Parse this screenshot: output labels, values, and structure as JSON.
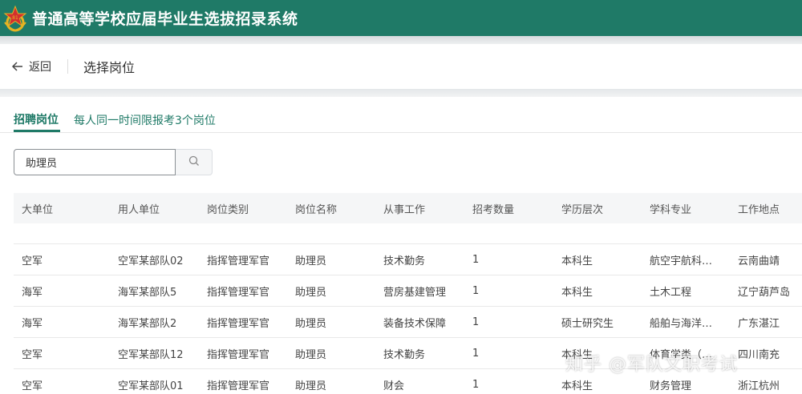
{
  "app": {
    "title": "普通高等学校应届毕业生选拔招录系统",
    "brand_color": "#1f7a67"
  },
  "subheader": {
    "back_label": "返回",
    "page_title": "选择岗位"
  },
  "tabs": {
    "active_label": "招聘岗位",
    "note": "每人同一时间限报考3个岗位"
  },
  "search": {
    "value": "助理员"
  },
  "table": {
    "headers": [
      "大单位",
      "用人单位",
      "岗位类别",
      "岗位名称",
      "从事工作",
      "招考数量",
      "学历层次",
      "学科专业",
      "工作地点"
    ],
    "rows": [
      [
        "空军",
        "空军某部队02",
        "指挥管理军官",
        "助理员",
        "技术勤务",
        "1",
        "本科生",
        "航空宇航科学...",
        "云南曲靖"
      ],
      [
        "海军",
        "海军某部队5",
        "指挥管理军官",
        "助理员",
        "营房基建管理",
        "1",
        "本科生",
        "土木工程",
        "辽宁葫芦岛"
      ],
      [
        "海军",
        "海军某部队2",
        "指挥管理军官",
        "助理员",
        "装备技术保障",
        "1",
        "硕士研究生",
        "船舶与海洋工程",
        "广东湛江"
      ],
      [
        "空军",
        "空军某部队12",
        "指挥管理军官",
        "助理员",
        "技术勤务",
        "1",
        "本科生",
        "体育学类（运...",
        "四川南充"
      ],
      [
        "空军",
        "空军某部队01",
        "指挥管理军官",
        "助理员",
        "财会",
        "1",
        "本科生",
        "财务管理",
        "浙江杭州"
      ]
    ]
  },
  "watermark": "知乎 @军队文职考试"
}
